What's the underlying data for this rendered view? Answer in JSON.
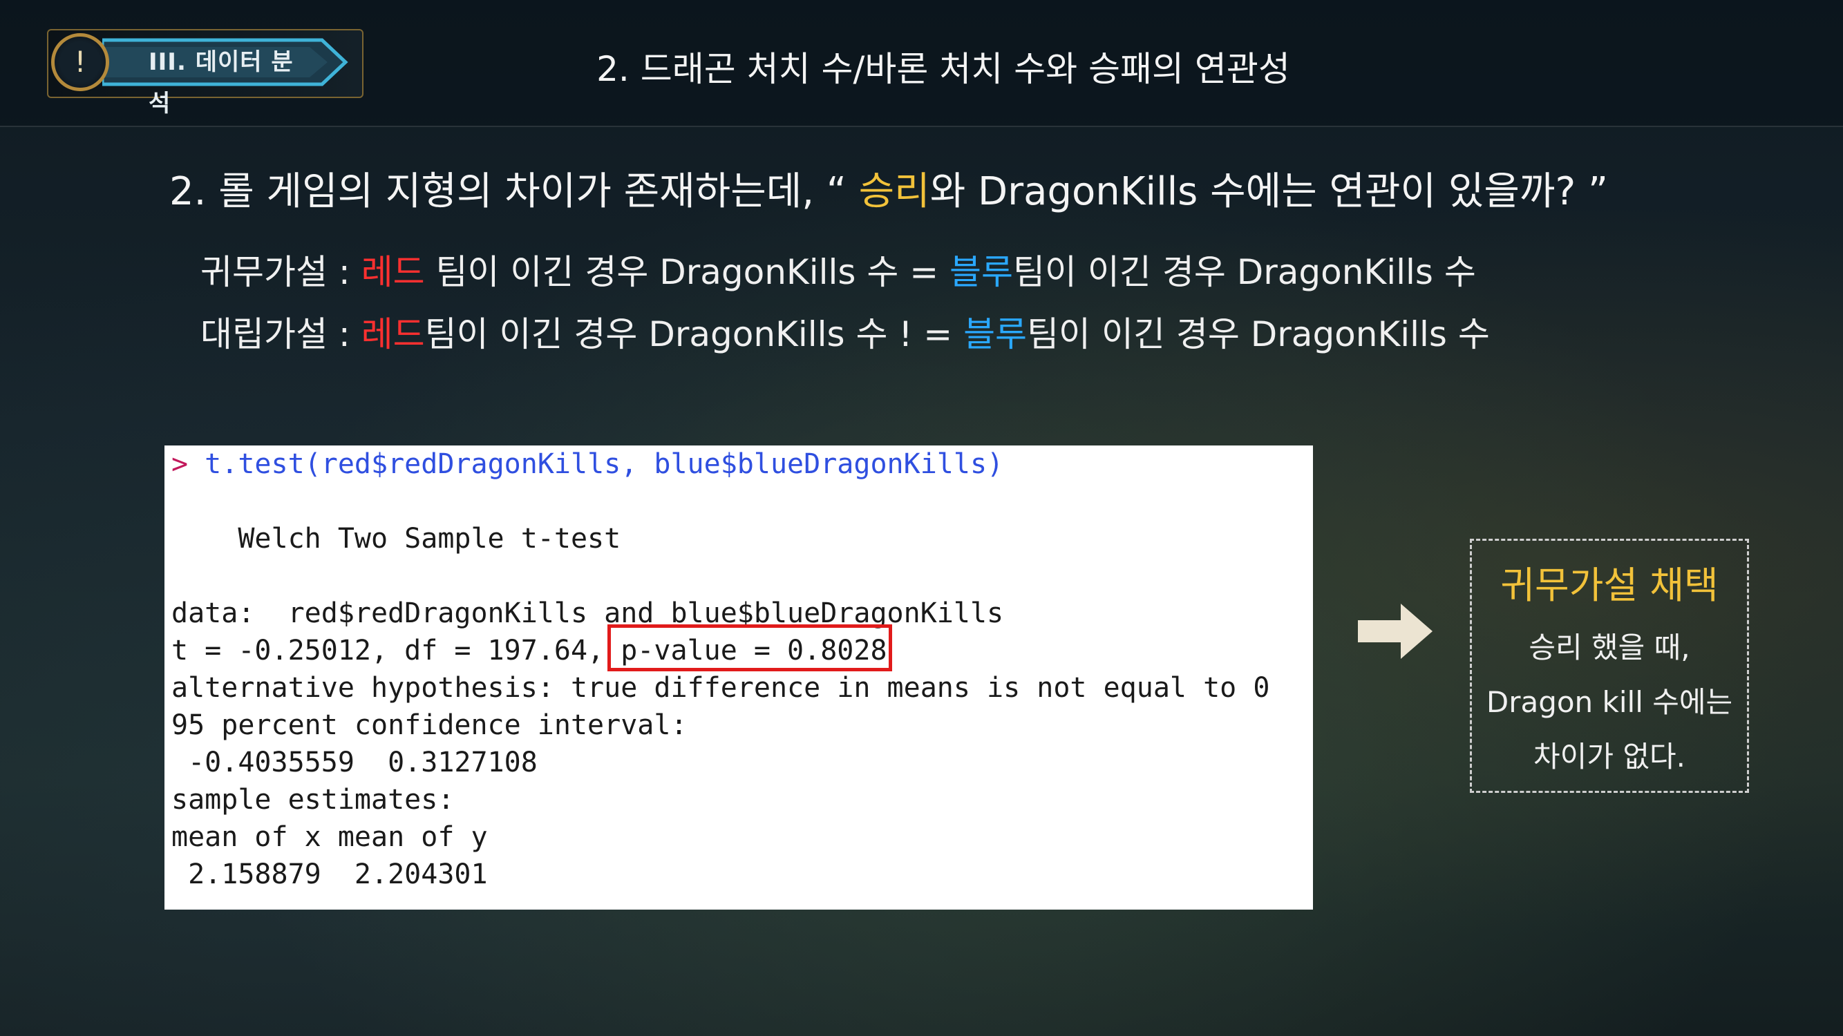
{
  "header": {
    "badge_icon": "!",
    "section_label": "III. 데이터 분석",
    "title": "2. 드래곤 처치 수/바론 처치 수와 승패의 연관성"
  },
  "question": {
    "prefix": "2. 롤 게임의 지형의 차이가 존재하는데, “ ",
    "highlight": "승리",
    "suffix": "와 DragonKills 수에는 연관이 있을까? ”"
  },
  "hypotheses": {
    "null": {
      "label": "귀무가설 :  ",
      "red_team": "레드",
      "part1": " 팀이 이긴 경우 DragonKills 수 = ",
      "blue_team": "블루",
      "part2": "팀이 이긴 경우 DragonKills  수"
    },
    "alt": {
      "label": "대립가설 :  ",
      "red_team": "레드",
      "part1": "팀이 이긴 경우 DragonKills 수 ! = ",
      "blue_team": "블루",
      "part2": "팀이 이긴 경우 DragonKills 수"
    }
  },
  "console": {
    "prompt": ">",
    "command": " t.test(red$redDragonKills, blue$blueDragonKills)",
    "lines": [
      "",
      "    Welch Two Sample t-test",
      "",
      "data:  red$redDragonKills and blue$blueDragonKills",
      "t = -0.25012, df = 197.64, p-value = 0.8028",
      "alternative hypothesis: true difference in means is not equal to 0",
      "95 percent confidence interval:",
      " -0.4035559  0.3127108",
      "sample estimates:",
      "mean of x mean of y",
      " 2.158879  2.204301"
    ]
  },
  "conclusion": {
    "title": "귀무가설 채택",
    "line1": "승리 했을 때,",
    "line2": "Dragon kill 수에는",
    "line3": "차이가 없다."
  },
  "colors": {
    "gold": "#f2c23a",
    "red": "#ff3030",
    "blue": "#2aa8ff",
    "highlight_box": "#e11b1b"
  },
  "icons": {
    "badge": "exclamation-icon",
    "arrow": "right-arrow-icon"
  }
}
